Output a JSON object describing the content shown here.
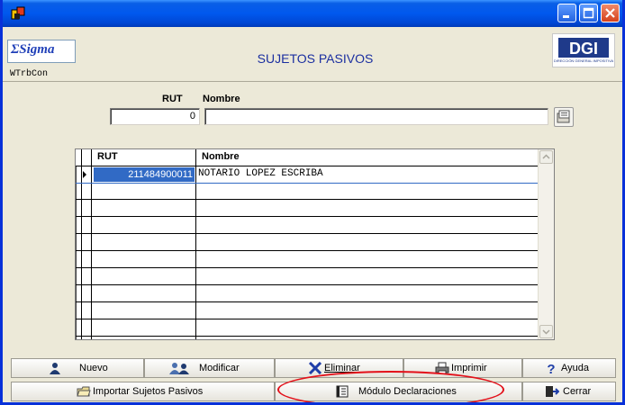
{
  "window": {
    "title": "",
    "app_icon": "app-icon",
    "controls": [
      "minimize-icon",
      "maximize-icon",
      "close-icon"
    ]
  },
  "header": {
    "logo_text": "ΣSigma",
    "app_code": "WTrbCon",
    "page_title": "SUJETOS PASIVOS",
    "dgi_text": "DIRECCIÓN GENERAL IMPOSITIVA"
  },
  "filters": {
    "rut_label": "RUT",
    "nombre_label": "Nombre",
    "rut_value": "0",
    "nombre_value": ""
  },
  "grid": {
    "columns": [
      "RUT",
      "Nombre"
    ],
    "rows": [
      {
        "rut": "211484900011",
        "nombre": "NOTARIO LOPEZ ESCRIBA"
      }
    ]
  },
  "toolbar": {
    "nuevo": "Nuevo",
    "modificar": "Modificar",
    "eliminar": "Eliminar",
    "imprimir": "Imprimir",
    "ayuda": "Ayuda",
    "importar": "Importar Sujetos Pasivos",
    "modulo": "Módulo Declaraciones",
    "cerrar": "Cerrar"
  },
  "colors": {
    "titlebar": "#0058ee",
    "accent": "#1b2fa0",
    "highlight": "#e3101a",
    "selected": "#316ac5"
  }
}
